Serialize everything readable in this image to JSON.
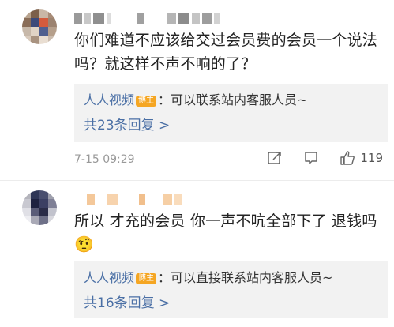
{
  "comments": [
    {
      "text_line1": "你们难道不应该给交过会员费的会员一个说法",
      "text_line2": "吗？就这样不声不响的了？",
      "reply_preview": {
        "author": "人人视频",
        "badge": "博主",
        "text": "：可以联系站内客服人员~",
        "count_label": "共23条回复 >"
      },
      "timestamp": "7-15 09:29",
      "likes": "119",
      "icons": [
        "share-icon",
        "comment-icon",
        "like-icon"
      ]
    },
    {
      "text_line1": "所以 才充的会员 你一声不吭全部下了 退钱吗",
      "emoji": "🤨",
      "reply_preview": {
        "author": "人人视频",
        "badge": "博主",
        "text": "：可以直接联系站内客服人员~",
        "count_label": "共16条回复 >"
      }
    }
  ],
  "colors": {
    "link_blue": "#4a6fa5",
    "badge_orange": "#f5a623",
    "reply_bg": "#f2f2f2",
    "meta_gray": "#999999"
  }
}
